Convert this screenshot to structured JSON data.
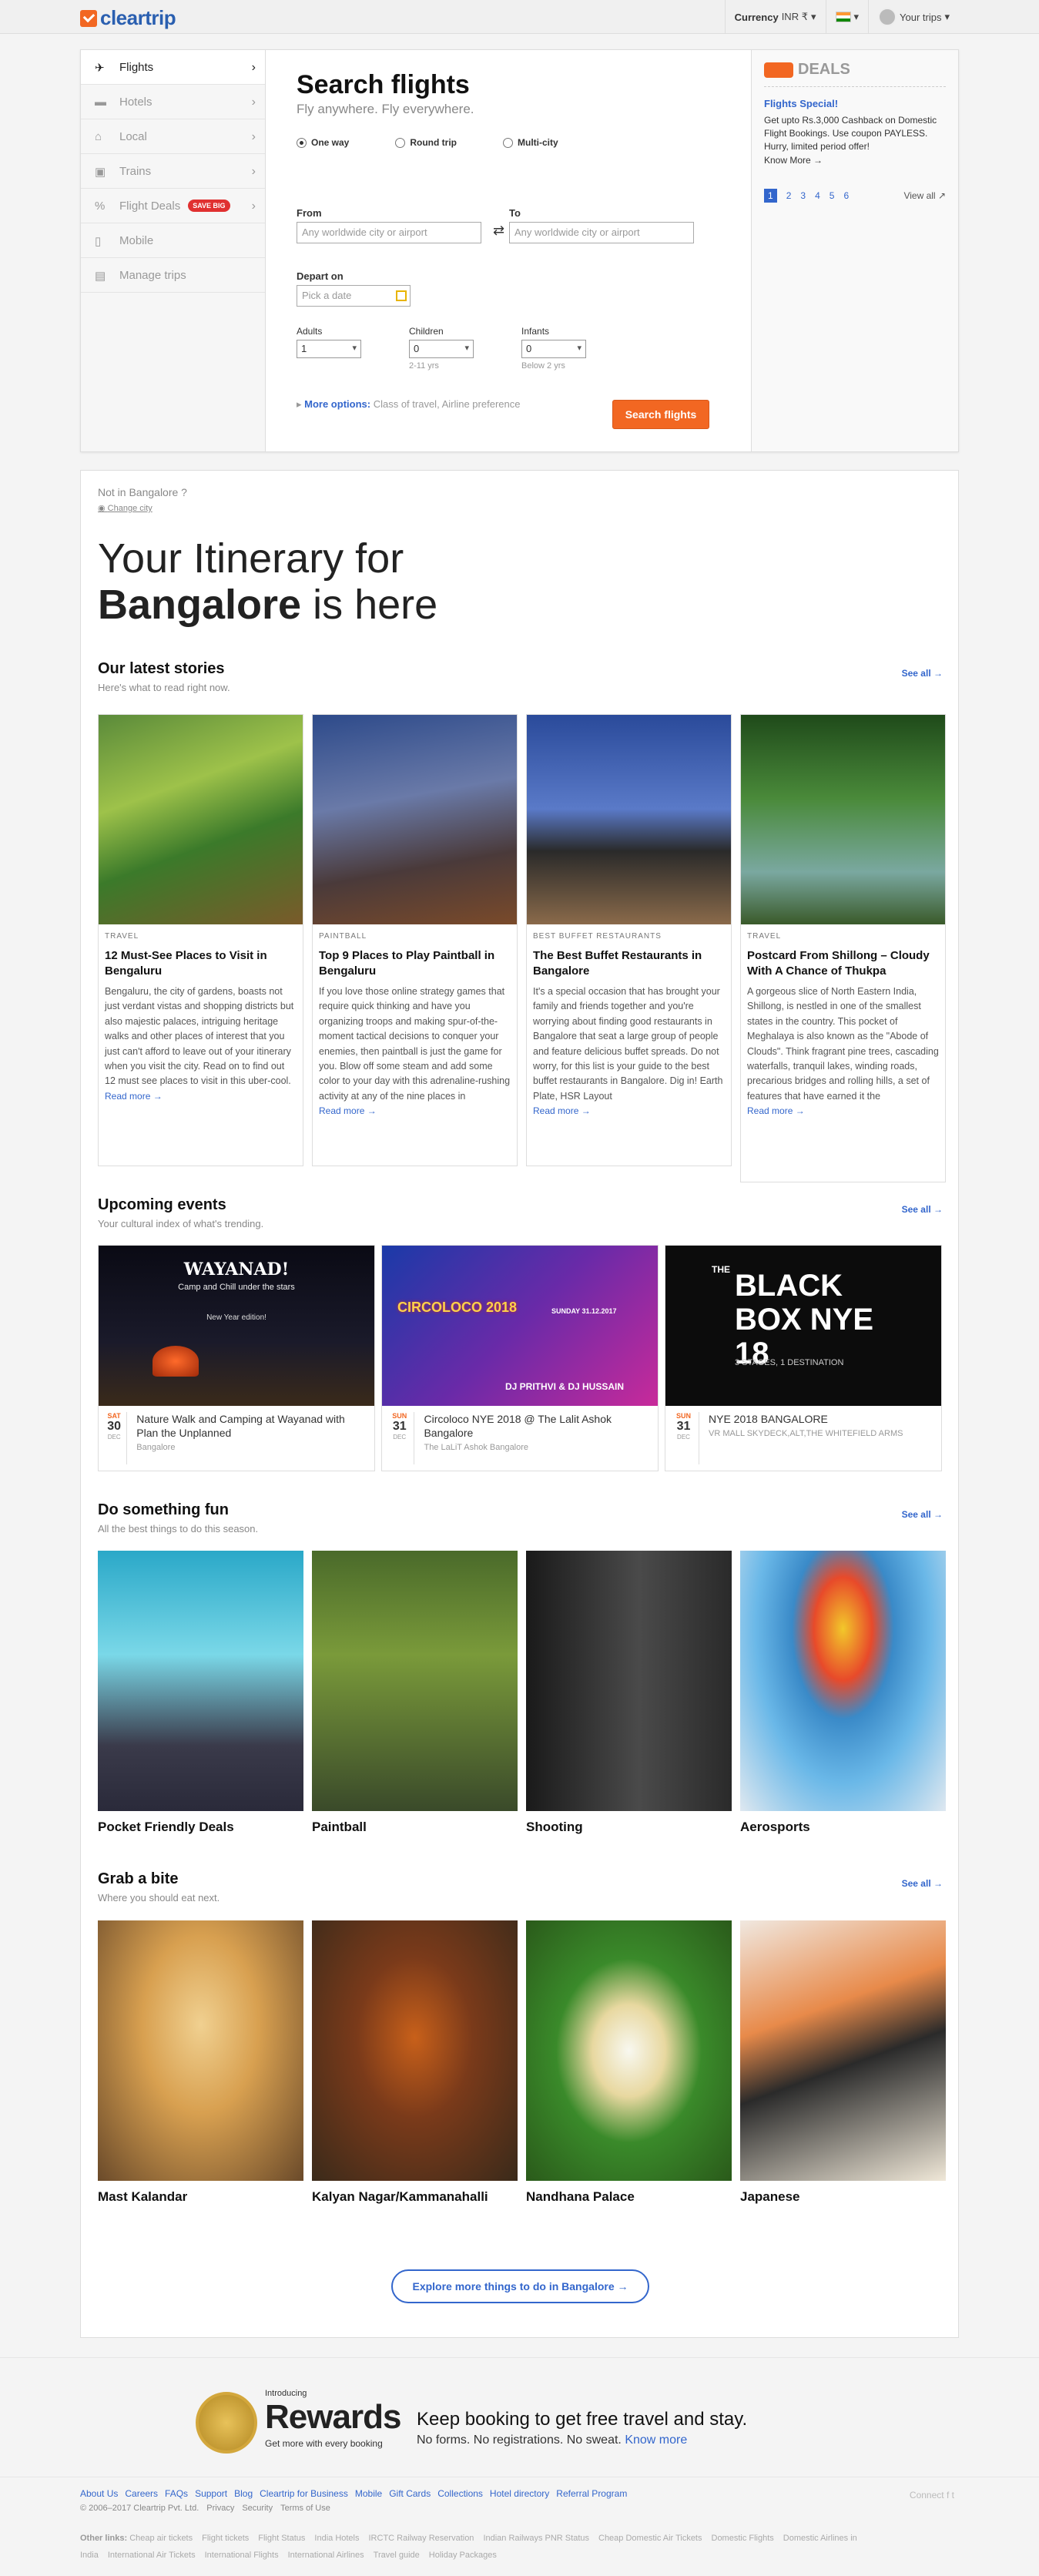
{
  "header": {
    "logo": "cleartrip",
    "currency_label": "Currency",
    "currency_value": "INR ₹",
    "trips": "Your trips"
  },
  "nav": [
    {
      "label": "Flights",
      "icon": "plane-icon",
      "active": true
    },
    {
      "label": "Hotels",
      "icon": "bed-icon"
    },
    {
      "label": "Local",
      "icon": "local-icon"
    },
    {
      "label": "Trains",
      "icon": "train-icon"
    },
    {
      "label": "Flight Deals",
      "icon": "percent-icon",
      "badge": "SAVE BIG"
    },
    {
      "label": "Mobile",
      "icon": "mobile-icon"
    },
    {
      "label": "Manage trips",
      "icon": "briefcase-icon"
    }
  ],
  "search": {
    "title": "Search flights",
    "tagline": "Fly anywhere. Fly everywhere.",
    "trip_types": [
      "One way",
      "Round trip",
      "Multi-city"
    ],
    "from_label": "From",
    "to_label": "To",
    "from_placeholder": "Any worldwide city or airport",
    "to_placeholder": "Any worldwide city or airport",
    "depart_label": "Depart on",
    "depart_placeholder": "Pick a date",
    "adults_label": "Adults",
    "adults_value": "1",
    "children_label": "Children",
    "children_value": "0",
    "children_hint": "2-11 yrs",
    "infants_label": "Infants",
    "infants_value": "0",
    "infants_hint": "Below 2 yrs",
    "more_label": "More options:",
    "more_text": "Class of travel, Airline preference",
    "button": "Search flights"
  },
  "deals": {
    "heading": "DEALS",
    "title": "Flights Special!",
    "text": "Get upto Rs.3,000 Cashback on Domestic Flight Bookings. Use coupon PAYLESS. Hurry, limited period offer!",
    "know_more": "Know More →",
    "pages": [
      "1",
      "2",
      "3",
      "4",
      "5",
      "6"
    ],
    "view_all": "View all"
  },
  "city": {
    "not_in": "Not in Bangalore ?",
    "change": "Change city",
    "itin_prefix": "Your Itinerary for",
    "city": "Bangalore",
    "itin_suffix": " is here"
  },
  "stories": {
    "heading": "Our latest stories",
    "sub": "Here's what to read right now.",
    "see_all": "See all →",
    "read_more": "Read more →",
    "items": [
      {
        "cat": "TRAVEL",
        "title": "12 Must-See Places to Visit in Bengaluru",
        "text": "Bengaluru, the city of gardens, boasts not just verdant vistas and shopping districts but also majestic palaces, intriguing heritage walks and other places of interest that you just can't afford to leave out of your itinerary when you visit the city. Read on to find out 12 must see places to visit in this uber-cool."
      },
      {
        "cat": "PAINTBALL",
        "title": "Top 9 Places to Play Paintball in Bengaluru",
        "text": "If you love those online strategy games that require quick thinking and have you organizing troops and making spur-of-the-moment tactical decisions to conquer your enemies, then paintball is just the game for you. Blow off some steam and add some color to your day with this adrenaline-rushing activity at any of the nine places in"
      },
      {
        "cat": "BEST BUFFET RESTAURANTS",
        "title": "The Best Buffet Restaurants in Bangalore",
        "text": "It's a special occasion that has brought your family and friends together and you're worrying about finding good restaurants in Bangalore that seat a large group of people and feature delicious buffet spreads. Do not worry, for this list is your guide to the best buffet restaurants in Bangalore. Dig in! Earth Plate, HSR Layout"
      },
      {
        "cat": "TRAVEL",
        "title": "Postcard From Shillong – Cloudy With A Chance of Thukpa",
        "text": "A gorgeous slice of North Eastern India, Shillong, is nestled in one of the smallest states in the country. This pocket of Meghalaya is also known as the \"Abode of Clouds\". Think fragrant pine trees, cascading waterfalls, tranquil lakes, winding roads, precarious bridges and rolling hills, a set of features that have earned it the"
      }
    ]
  },
  "events": {
    "heading": "Upcoming events",
    "sub": "Your cultural index of what's trending.",
    "see_all": "See all →",
    "items": [
      {
        "dow": "SAT",
        "day": "30",
        "mon": "DEC",
        "title": "Nature Walk and Camping at Wayanad with Plan the Unplanned",
        "venue": "Bangalore",
        "poster_title": "WAYANAD!",
        "poster_sub": "Camp and Chill under the stars",
        "poster_note": "New Year edition!"
      },
      {
        "dow": "SUN",
        "day": "31",
        "mon": "DEC",
        "title": "Circoloco NYE 2018 @ The Lalit Ashok Bangalore",
        "venue": "The LaLiT Ashok Bangalore",
        "poster_title": "CIRCOLOCO 2018",
        "poster_sub": "DJ PRITHVI & DJ HUSSAIN",
        "poster_note": "SUNDAY 31.12.2017"
      },
      {
        "dow": "SUN",
        "day": "31",
        "mon": "DEC",
        "title": "NYE 2018 BANGALORE",
        "venue": "VR MALL SKYDECK,ALT,THE WHITEFIELD ARMS",
        "poster_title": "BLACK BOX NYE 18",
        "poster_sub": "3 STAGES, 1 DESTINATION",
        "poster_note": "THE"
      }
    ]
  },
  "fun": {
    "heading": "Do something fun",
    "sub": "All the best things to do this season.",
    "see_all": "See all →",
    "items": [
      "Pocket Friendly Deals",
      "Paintball",
      "Shooting",
      "Aerosports"
    ]
  },
  "bite": {
    "heading": "Grab a bite",
    "sub": "Where you should eat next.",
    "see_all": "See all →",
    "items": [
      "Mast Kalandar",
      "Kalyan Nagar/Kammanahalli",
      "Nandhana Palace",
      "Japanese"
    ]
  },
  "explore": "Explore more things to do in Bangalore →",
  "rewards": {
    "intro": "Introducing",
    "name": "Rewards",
    "tag": "Get more with every booking",
    "main": "Keep booking to get free travel and stay.",
    "sub": "No forms. No registrations. No sweat.",
    "know": "Know more"
  },
  "footer": {
    "links": [
      "About Us",
      "Careers",
      "FAQs",
      "Support",
      "Blog",
      "Cleartrip for Business",
      "Mobile",
      "Gift Cards",
      "Collections",
      "Hotel directory",
      "Referral Program"
    ],
    "copy": [
      "© 2006–2017 Cleartrip Pvt. Ltd.",
      "Privacy",
      "Security",
      "Terms of Use"
    ],
    "connect": "Connect",
    "other_label": "Other links:",
    "other": [
      "Cheap air tickets",
      "Flight tickets",
      "Flight Status",
      "India Hotels",
      "IRCTC Railway Reservation",
      "Indian Railways PNR Status",
      "Cheap Domestic Air Tickets",
      "Domestic Flights",
      "Domestic Airlines in India",
      "International Air Tickets",
      "International Flights",
      "International Airlines",
      "Travel guide",
      "Holiday Packages"
    ]
  }
}
